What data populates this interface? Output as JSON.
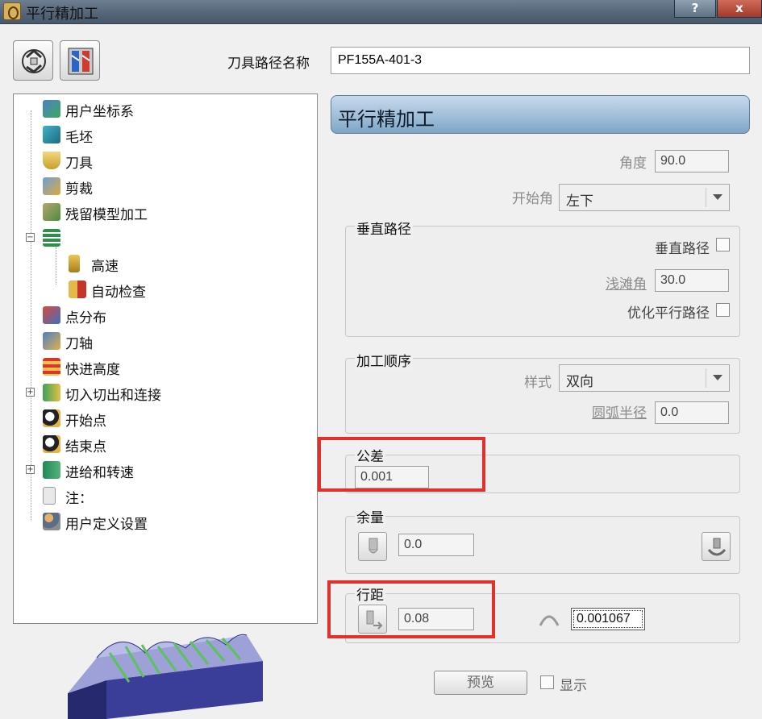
{
  "window": {
    "title": "平行精加工",
    "help_label": "?",
    "close_label": "x"
  },
  "toolbar": {
    "path_name_label": "刀具路径名称",
    "path_name_value": "PF155A-401-3"
  },
  "tree": {
    "items": [
      {
        "label": "用户坐标系",
        "icon": "coordinate-system-icon"
      },
      {
        "label": "毛坯",
        "icon": "block-icon"
      },
      {
        "label": "刀具",
        "icon": "tool-icon"
      },
      {
        "label": "剪裁",
        "icon": "trim-icon"
      },
      {
        "label": "残留模型加工",
        "icon": "rest-model-icon"
      },
      {
        "label": "",
        "icon": "strategy-icon"
      },
      {
        "label": "高速",
        "icon": "high-speed-icon"
      },
      {
        "label": "自动检查",
        "icon": "auto-check-icon"
      },
      {
        "label": "点分布",
        "icon": "point-distribution-icon"
      },
      {
        "label": "刀轴",
        "icon": "tool-axis-icon"
      },
      {
        "label": "快进高度",
        "icon": "rapid-height-icon"
      },
      {
        "label": "切入切出和连接",
        "icon": "leads-links-icon"
      },
      {
        "label": "开始点",
        "icon": "start-point-icon"
      },
      {
        "label": "结束点",
        "icon": "end-point-icon"
      },
      {
        "label": "进给和转速",
        "icon": "feeds-speeds-icon"
      },
      {
        "label": "注：",
        "icon": "notes-icon"
      },
      {
        "label": "用户定义设置",
        "icon": "user-settings-icon"
      }
    ]
  },
  "panel": {
    "header": "平行精加工",
    "angle_label": "角度",
    "angle_value": "90.0",
    "start_corner_label": "开始角",
    "start_corner_value": "左下",
    "vertical_group_title": "垂直路径",
    "vertical_path_label": "垂直路径",
    "shallow_angle_label": "浅滩角",
    "shallow_angle_value": "30.0",
    "optimize_label": "优化平行路径",
    "order_group_title": "加工顺序",
    "style_label": "样式",
    "style_value": "双向",
    "arc_radius_label": "圆弧半径",
    "arc_radius_value": "0.0",
    "tolerance_title": "公差",
    "tolerance_value": "0.001",
    "thickness_title": "余量",
    "thickness_value": "0.0",
    "stepover_title": "行距",
    "stepover_value": "0.08",
    "cusp_value": "0.001067",
    "preview_label": "预览",
    "display_label": "显示"
  },
  "colors": {
    "highlight": "#e3302b",
    "header_blue": "#9dbcd8"
  }
}
